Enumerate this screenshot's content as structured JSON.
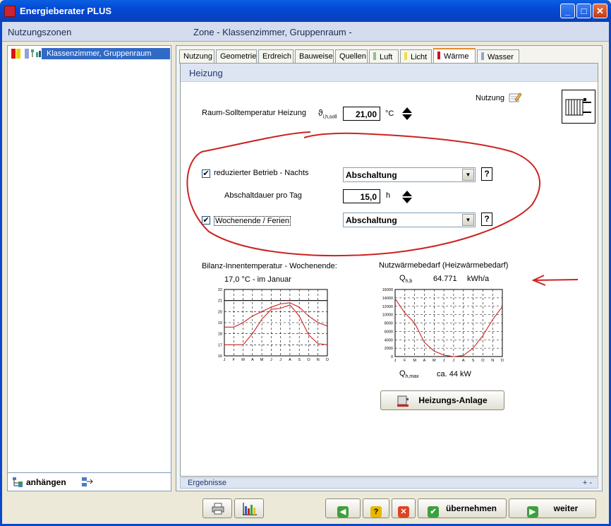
{
  "window": {
    "title": "Energieberater PLUS",
    "minimize": "_",
    "maximize": "□",
    "close": "✕"
  },
  "header": {
    "zones_label": "Nutzungszonen",
    "zone_label": "Zone   - Klassenzimmer, Gruppenraum -"
  },
  "tree": {
    "items": [
      {
        "label": "Klassenzimmer, Gruppenraum"
      }
    ]
  },
  "left_footer": {
    "attach_label": "anhängen"
  },
  "tabs": [
    {
      "label": "Nutzung"
    },
    {
      "label": "Geometrie"
    },
    {
      "label": "Erdreich"
    },
    {
      "label": "Bauweise"
    },
    {
      "label": "Quellen"
    },
    {
      "label": "Luft",
      "color": "#8fbf8f"
    },
    {
      "label": "Licht",
      "color": "#f0e040"
    },
    {
      "label": "Wärme",
      "color": "#cc1122"
    },
    {
      "label": "Wasser",
      "color": "#8ea4d8"
    }
  ],
  "section": {
    "title": "Heizung",
    "nutzung_link": "Nutzung"
  },
  "heating": {
    "room_temp_label": "Raum-Solltemperatur Heizung",
    "room_temp_symbol": "ϑ",
    "room_temp_subscript": "i,h,soll",
    "room_temp_value": "21,00",
    "room_temp_unit": "°C",
    "reduced_label": "reduzierter Betrieb  -  Nachts",
    "reduced_checked": "✔",
    "reduced_mode": "Abschaltung",
    "duration_label": "Abschaltdauer pro Tag",
    "duration_value": "15,0",
    "duration_unit": "h",
    "weekend_label": "Wochenende / Ferien",
    "weekend_checked": "✔",
    "weekend_mode": "Abschaltung",
    "help": "?"
  },
  "bilanz": {
    "title": "Bilanz-Innentemperatur - Wochenende:",
    "value_line": "17,0  °C  -  im Januar"
  },
  "nutzwaerme": {
    "title": "Nutzwärmebedarf (Heizwärmebedarf)",
    "q_symbol": "Q",
    "q_subscript": "h,b",
    "q_value": "64.771",
    "q_unit": "kWh/a",
    "qmax_symbol": "Q",
    "qmax_subscript": "h,max",
    "qmax_value": "ca. 44  kW"
  },
  "heizungs_anlage_button": "Heizungs-Anlage",
  "results_bar": {
    "label": "Ergebnisse",
    "controls": "+ -"
  },
  "bottom_buttons": {
    "confirm": "übernehmen",
    "next": "weiter",
    "help": "?",
    "cancel": "✕",
    "back": "◀",
    "forward": "▶",
    "ok": "✔"
  },
  "chart_data": [
    {
      "type": "line",
      "categories": [
        "J",
        "F",
        "M",
        "A",
        "M",
        "J",
        "J",
        "A",
        "S",
        "O",
        "N",
        "D"
      ],
      "ylim": [
        16,
        22
      ],
      "yticks": [
        16,
        17,
        18,
        19,
        20,
        21,
        22
      ],
      "series": [
        {
          "values": [
            18.6,
            18.6,
            19.0,
            19.6,
            20.0,
            20.4,
            20.7,
            20.8,
            20.4,
            19.6,
            19.0,
            18.7
          ],
          "color": "#cc2222"
        },
        {
          "values": [
            17.0,
            17.0,
            17.0,
            18.0,
            19.3,
            20.2,
            20.3,
            20.6,
            19.6,
            17.9,
            17.1,
            17.0
          ],
          "color": "#cc2222"
        },
        {
          "values": [
            21,
            21,
            21,
            21,
            21,
            21,
            21,
            21,
            21,
            21,
            21,
            21
          ],
          "color": "#000000"
        }
      ],
      "grid": true
    },
    {
      "type": "line",
      "categories": [
        "J",
        "F",
        "M",
        "A",
        "M",
        "J",
        "J",
        "A",
        "S",
        "O",
        "N",
        "D"
      ],
      "ylim": [
        0,
        16000
      ],
      "yticks": [
        0,
        2000,
        4000,
        6000,
        8000,
        10000,
        12000,
        14000,
        16000
      ],
      "series": [
        {
          "values": [
            13800,
            10400,
            8000,
            3400,
            1300,
            350,
            0,
            250,
            2000,
            5000,
            8800,
            11900
          ],
          "color": "#cc2222"
        }
      ],
      "grid": true
    }
  ]
}
